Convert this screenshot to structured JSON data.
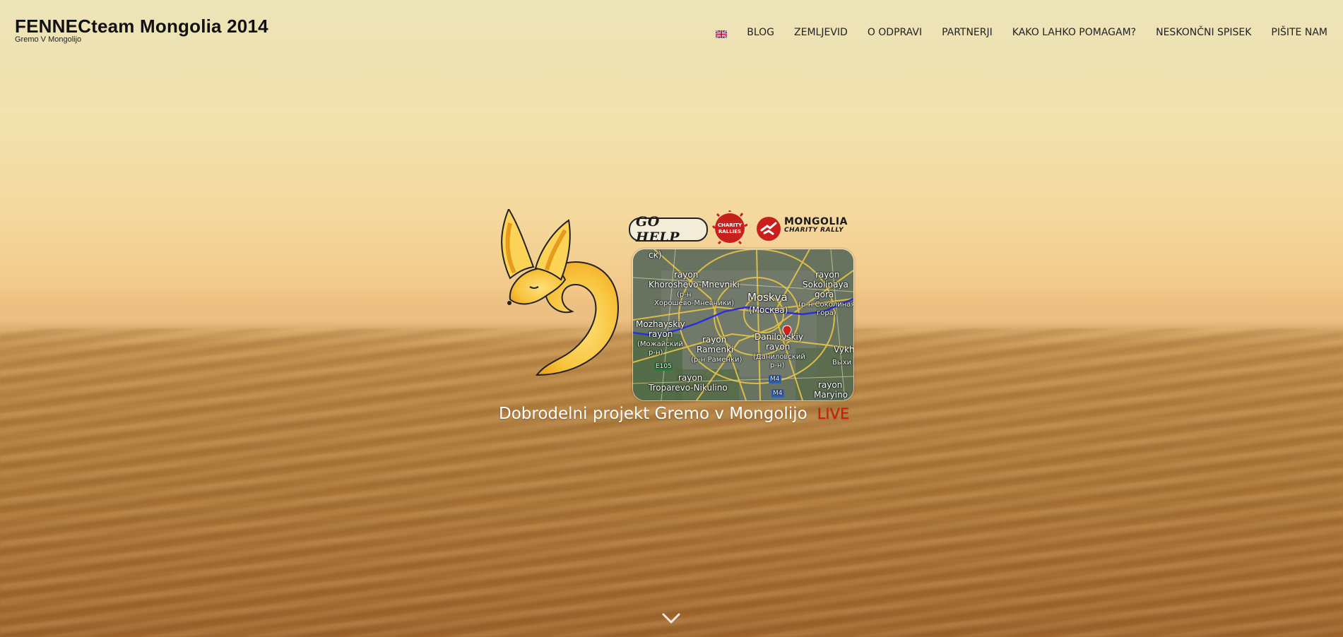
{
  "header": {
    "title": "FENNECteam Mongolia 2014",
    "tagline": "Gremo V Mongolijo"
  },
  "nav": {
    "language_icon": "uk-flag-icon",
    "items": [
      "BLOG",
      "ZEMLJEVID",
      "O ODPRAVI",
      "PARTNERJI",
      "KAKO LAHKO POMAGAM?",
      "NESKONČNI SPISEK",
      "PIŠITE NAM"
    ]
  },
  "sponsors": {
    "gohelp": "GO HELP",
    "charity_line1": "CHARITY",
    "charity_line2": "RALLIES",
    "mongolia_line1": "MONGOLIA",
    "mongolia_line2": "CHARITY RALLY"
  },
  "map": {
    "labels": [
      "rayon",
      "Khoroshevo-Mnevniki",
      "(р-н",
      "Хорошево-Мневники)",
      "Moskva",
      "(Москва)",
      "rayon",
      "Sokolinaya",
      "gora",
      "(р-н Соколиная",
      "гора)",
      "Mozhayskiy",
      "rayon",
      "(Можайский",
      "р-н)",
      "E105",
      "rayon",
      "Ramenki",
      "(р-н Раменки)",
      "Danilovskiy",
      "rayon",
      "(Даниловский",
      "р-н)",
      "rayon",
      "Troparevo-Nikulino",
      "M4",
      "M4",
      "Vykh",
      "rayon",
      "Maryino",
      "Выхи",
      "ск)"
    ]
  },
  "hero": {
    "title": "Dobrodelni projekt Gremo v Mongolijo",
    "live": "LIVE"
  },
  "icons": {
    "scroll": "chevron-down-icon",
    "logo": "fennec-fox-logo"
  },
  "colors": {
    "live": "#cc1a10",
    "title": "#111111",
    "nav": "#222222"
  }
}
